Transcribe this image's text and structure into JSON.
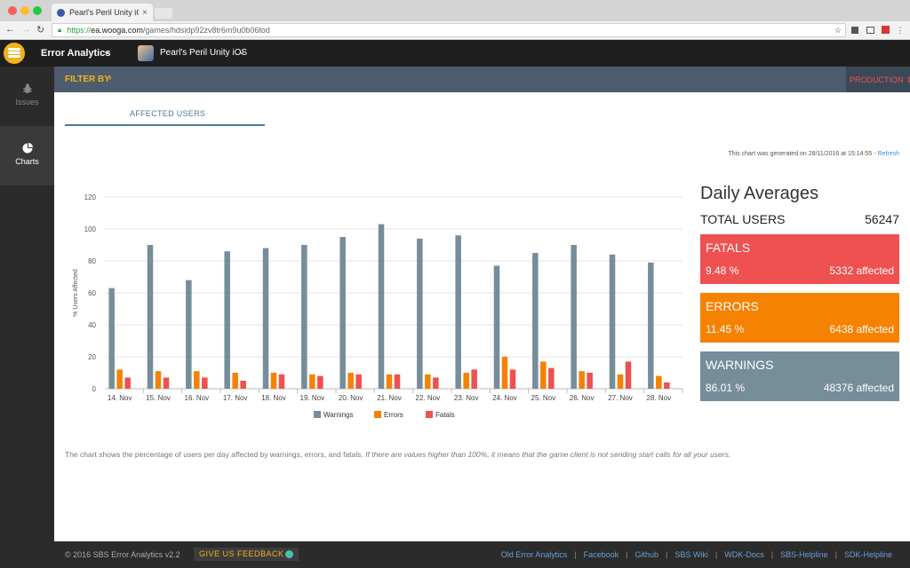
{
  "browser": {
    "tab_title": "Pearl's Peril Unity iOS",
    "tab_close": "×",
    "url_scheme": "https://",
    "url_host": "ea.wooga.com",
    "url_path": "/games/hdsidp92zv8tr6m9u0b06tod"
  },
  "header": {
    "app_name": "Error Analytics",
    "game_name": "Pearl's Peril Unity iOS"
  },
  "sidebar": {
    "items": [
      {
        "label": "Issues",
        "icon": "bug-icon"
      },
      {
        "label": "Charts",
        "icon": "pie-chart-icon"
      }
    ]
  },
  "filter": {
    "label": "FILTER BY",
    "environment": "PRODUCTION"
  },
  "main": {
    "tab_label": "AFFECTED USERS",
    "generated_note": "This chart was generated on 28/11/2016 at 15:14:55 - ",
    "refresh_label": "Refresh",
    "description": "The chart shows the percentage of users per day affected by warnings, errors, and fatals.",
    "description_note": "If there are values higher than 100%, it means that the game client is not sending start calls for all your users."
  },
  "averages": {
    "title": "Daily Averages",
    "total_label": "TOTAL USERS",
    "total_value": "56247",
    "cards": [
      {
        "title": "FATALS",
        "pct": "9.48 %",
        "affected": "5332 affected",
        "color": "#ef5050"
      },
      {
        "title": "ERRORS",
        "pct": "11.45 %",
        "affected": "6438 affected",
        "color": "#f58200"
      },
      {
        "title": "WARNINGS",
        "pct": "86.01 %",
        "affected": "48376 affected",
        "color": "#768d9a"
      }
    ]
  },
  "chart_data": {
    "type": "bar",
    "ylabel": "% Users Affected",
    "ylim": [
      0,
      120
    ],
    "yticks": [
      0,
      20,
      40,
      60,
      80,
      100,
      120
    ],
    "categories": [
      "14. Nov",
      "15. Nov",
      "16. Nov",
      "17. Nov",
      "18. Nov",
      "19. Nov",
      "20. Nov",
      "21. Nov",
      "22. Nov",
      "23. Nov",
      "24. Nov",
      "25. Nov",
      "26. Nov",
      "27. Nov",
      "28. Nov"
    ],
    "series": [
      {
        "name": "Warnings",
        "color": "#768d9a",
        "values": [
          63,
          90,
          68,
          86,
          88,
          90,
          95,
          103,
          94,
          96,
          77,
          85,
          90,
          84,
          79
        ]
      },
      {
        "name": "Errors",
        "color": "#f58200",
        "values": [
          12,
          11,
          11,
          10,
          10,
          9,
          10,
          9,
          9,
          10,
          20,
          17,
          11,
          9,
          8
        ]
      },
      {
        "name": "Fatals",
        "color": "#ef5050",
        "values": [
          7,
          7,
          7,
          5,
          9,
          8,
          9,
          9,
          7,
          12,
          12,
          13,
          10,
          17,
          4
        ]
      }
    ],
    "grid": true,
    "legend": "bottom"
  },
  "footer": {
    "copyright": "© 2016 SBS Error Analytics v2.2",
    "feedback": "GIVE US FEEDBACK",
    "links": [
      "Old Error Analytics",
      "Facebook",
      "Github",
      "SBS Wiki",
      "WDK-Docs",
      "SBS-Helpline",
      "SDK-Helpline"
    ]
  }
}
